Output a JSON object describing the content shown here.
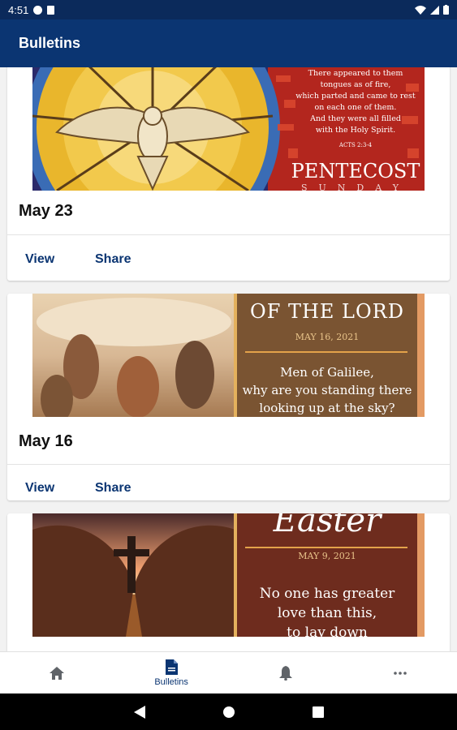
{
  "status_bar": {
    "time": "4:51"
  },
  "app_bar": {
    "title": "Bulletins"
  },
  "bulletins": [
    {
      "title": "May 23",
      "view_label": "View",
      "share_label": "Share",
      "image_text": {
        "verse_lines": [
          "There appeared to them",
          "tongues as of fire,",
          "which parted and came to rest",
          "on each one of them.",
          "And they were all filled",
          "with the Holy Spirit."
        ],
        "citation": "ACTS 2:3-4",
        "headline": "PENTECOST",
        "subheadline": "SUNDAY"
      }
    },
    {
      "title": "May 16",
      "view_label": "View",
      "share_label": "Share",
      "image_text": {
        "headline": "OF THE LORD",
        "date": "MAY 16, 2021",
        "quote_lines": [
          "Men of Galilee,",
          "why are you standing there",
          "looking up at the sky?"
        ]
      }
    },
    {
      "title": "",
      "view_label": "",
      "share_label": "",
      "image_text": {
        "headline": "Easter",
        "date": "MAY 9, 2021",
        "quote_lines": [
          "No one has greater",
          "love than this,",
          "to lay down"
        ]
      }
    }
  ],
  "bottom_nav": {
    "items": [
      {
        "label": "",
        "icon": "home-icon"
      },
      {
        "label": "Bulletins",
        "icon": "document-icon"
      },
      {
        "label": "",
        "icon": "bell-icon"
      },
      {
        "label": "",
        "icon": "more-icon"
      }
    ],
    "active_index": 1
  },
  "colors": {
    "primary": "#0b3572",
    "status_bar": "#0b2a5b"
  }
}
